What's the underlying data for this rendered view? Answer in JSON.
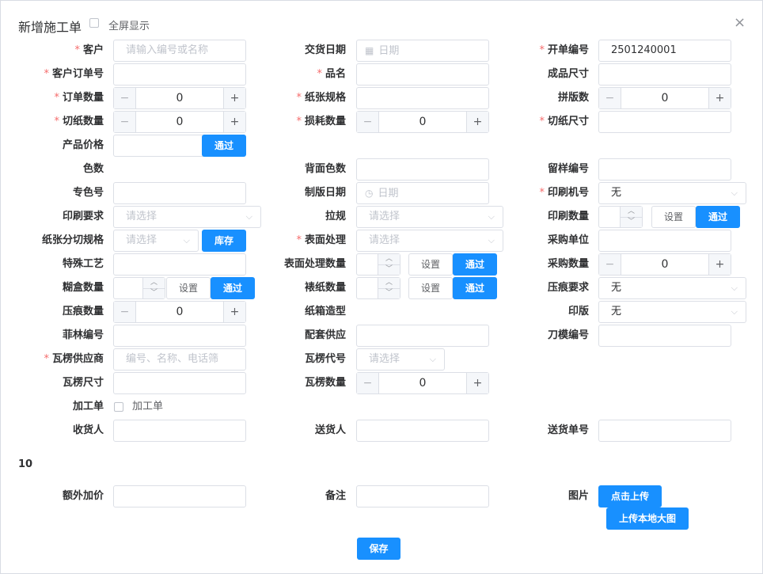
{
  "dialog": {
    "title": "新增施工单",
    "fullscreen_label": "全屏显示",
    "close_glyph": "×",
    "section_number": "10",
    "save_label": "保存"
  },
  "labels": {
    "customer": "客户",
    "delivery_date": "交货日期",
    "order_no": "开单编号",
    "customer_order_no": "客户订单号",
    "product_name": "品名",
    "finished_size": "成品尺寸",
    "order_qty": "订单数量",
    "paper_spec": "纸张规格",
    "imposition_count": "拼版数",
    "cut_qty": "切纸数量",
    "waste_qty": "损耗数量",
    "cut_size": "切纸尺寸",
    "product_price": "产品价格",
    "color_count": "色数",
    "back_color_count": "背面色数",
    "sample_no": "留样编号",
    "spot_color_no": "专色号",
    "plate_date": "制版日期",
    "press_no": "印刷机号",
    "print_requirement": "印刷要求",
    "pull_gauge": "拉规",
    "print_qty": "印刷数量",
    "paper_cut_spec": "纸张分切规格",
    "surface_treatment": "表面处理",
    "purchase_unit": "采购单位",
    "special_process": "特殊工艺",
    "surface_qty": "表面处理数量",
    "purchase_qty": "采购数量",
    "gluing_qty": "糊盒数量",
    "mounting_qty": "裱纸数量",
    "crease_requirement": "压痕要求",
    "crease_qty": "压痕数量",
    "box_shape": "纸箱造型",
    "plate": "印版",
    "film_no": "菲林编号",
    "supporting_supply": "配套供应",
    "die_no": "刀模编号",
    "corrugated_supplier": "瓦楞供应商",
    "corrugated_code": "瓦楞代号",
    "corrugated_size": "瓦楞尺寸",
    "corrugated_qty": "瓦楞数量",
    "processing_order": "加工单",
    "consignee": "收货人",
    "deliverer": "送货人",
    "delivery_no": "送货单号",
    "extra_price": "额外加价",
    "remark": "备注",
    "image": "图片"
  },
  "required_mark": "*",
  "placeholders": {
    "customer": "请输入编号或名称",
    "date": "日期",
    "select": "请选择",
    "corrugated_supplier": "编号、名称、电话筛"
  },
  "values": {
    "order_no": "2501240001",
    "order_qty": "0",
    "imposition_count": "0",
    "cut_qty": "0",
    "waste_qty": "0",
    "purchase_qty": "0",
    "crease_qty": "0",
    "corrugated_qty": "0",
    "press_no": "无",
    "crease_requirement": "无",
    "plate": "无"
  },
  "buttons": {
    "pass": "通过",
    "set": "设置",
    "stock": "库存",
    "upload_click": "点击上传",
    "upload_local": "上传本地大图"
  },
  "glyphs": {
    "minus": "−",
    "plus": "+",
    "chevron_down": "⌵",
    "spin_up": "︿",
    "spin_down": "﹀",
    "calendar": "▦",
    "clock": "◷"
  },
  "colors": {
    "primary": "#1890ff",
    "required": "#f56c6c",
    "border": "#dcdfe6",
    "placeholder": "#c0c4cc"
  }
}
